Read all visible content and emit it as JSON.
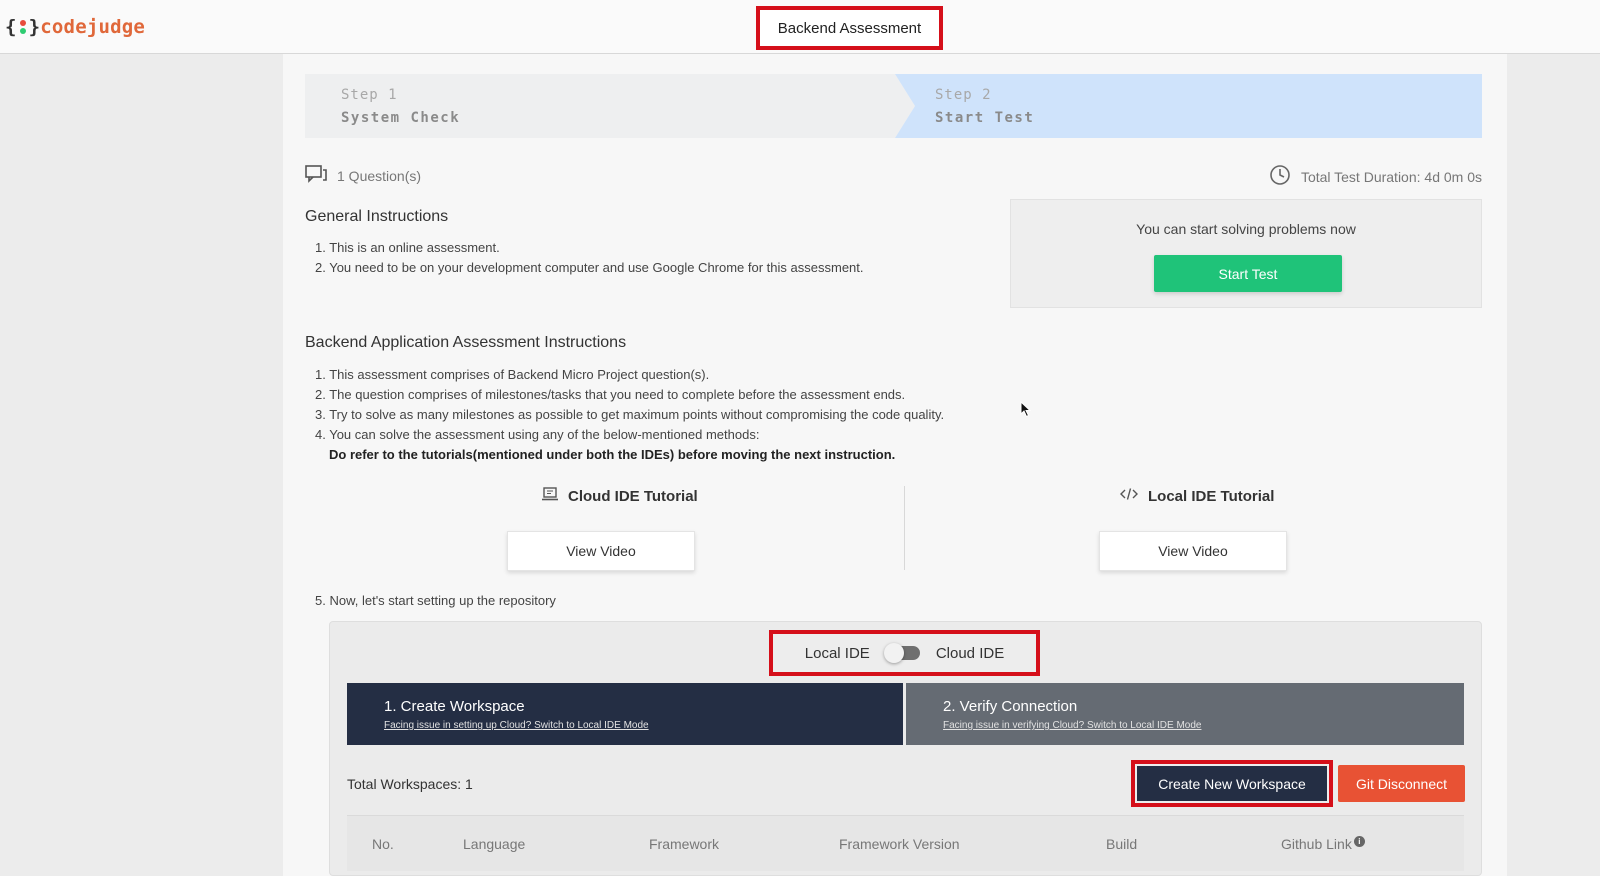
{
  "header": {
    "logo": {
      "open": "{",
      "close": "}",
      "name": "codejudge"
    },
    "title": "Backend Assessment"
  },
  "stepper": {
    "step1": {
      "number": "Step 1",
      "name": "System Check"
    },
    "step2": {
      "number": "Step 2",
      "name": "Start Test"
    }
  },
  "summary": {
    "questions": "1 Question(s)",
    "duration": "Total Test Duration: 4d 0m 0s"
  },
  "general": {
    "heading": "General Instructions",
    "items": [
      "1. This is an online assessment.",
      "2. You need to be on your development computer and use Google Chrome for this assessment."
    ]
  },
  "start": {
    "message": "You can start solving problems now",
    "button": "Start Test"
  },
  "backend": {
    "heading": "Backend Application Assessment Instructions",
    "items": [
      "1. This assessment comprises of Backend Micro Project question(s).",
      "2. The question comprises of milestones/tasks that you need to complete before the assessment ends.",
      "3. Try to solve as many milestones as possible to get maximum points without compromising the code quality.",
      "4. You can solve the assessment using any of the below-mentioned methods:"
    ],
    "note": "Do refer to the tutorials(mentioned under both the IDEs) before moving the next instruction."
  },
  "tutorials": {
    "cloud": {
      "title": "Cloud IDE Tutorial",
      "button": "View Video",
      "icon": "laptop-icon"
    },
    "local": {
      "title": "Local IDE Tutorial",
      "button": "View Video",
      "icon": "code-icon"
    }
  },
  "step5": "5. Now, let's start setting up the repository",
  "ide": {
    "left_label": "Local IDE",
    "right_label": "Cloud IDE",
    "tabs": [
      {
        "title": "1. Create Workspace",
        "link": "Facing issue in setting up Cloud? Switch to Local IDE Mode"
      },
      {
        "title": "2. Verify Connection",
        "link": "Facing issue in verifying Cloud? Switch to Local IDE Mode"
      }
    ],
    "total_workspaces": "Total Workspaces: 1",
    "create_button": "Create New Workspace",
    "git_button": "Git Disconnect",
    "columns": [
      "No.",
      "Language",
      "Framework",
      "Framework Version",
      "Build",
      "Github Link"
    ],
    "info_glyph": "i"
  },
  "colors": {
    "highlight": "#d50f1a",
    "start": "#1fc379",
    "navy": "#242e44",
    "git": "#e85234",
    "step_active": "#cfe3fb"
  }
}
